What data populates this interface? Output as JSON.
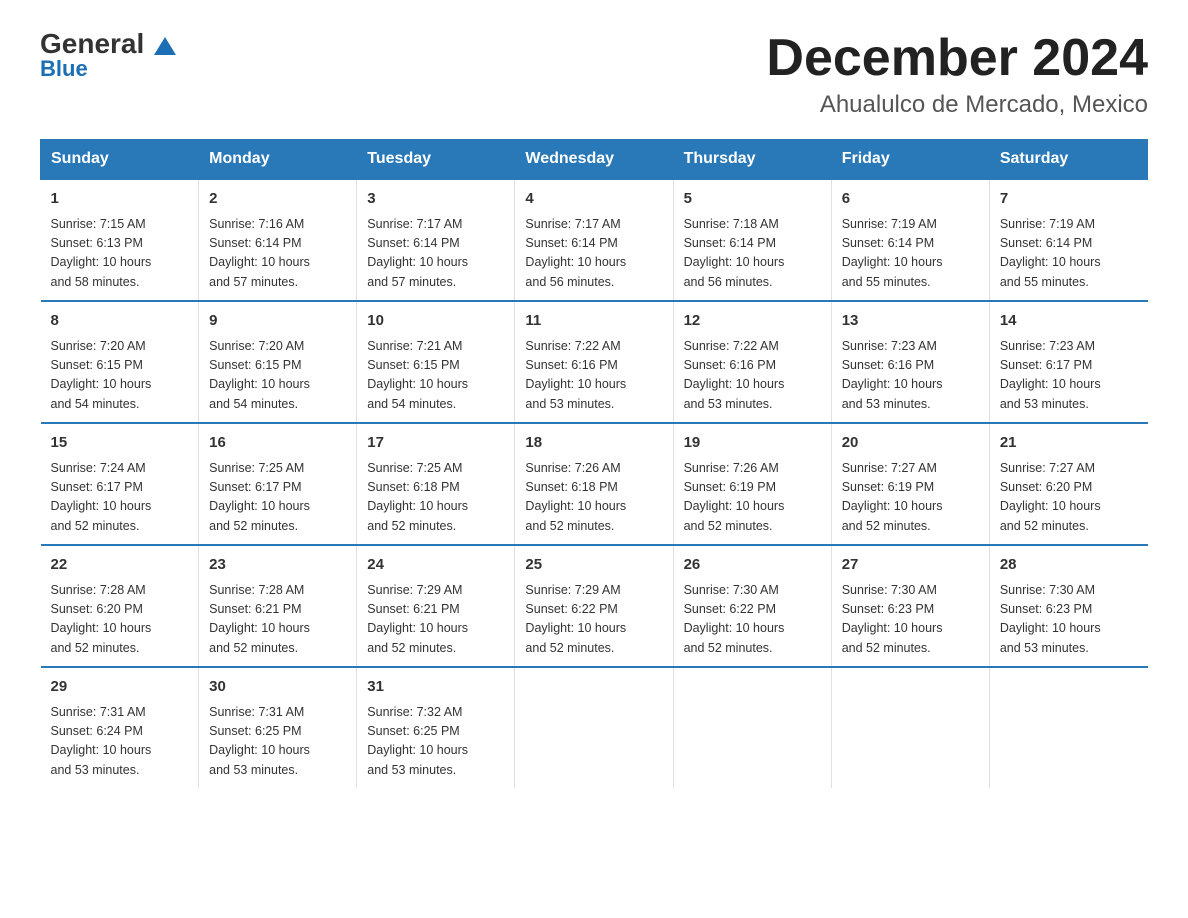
{
  "logo": {
    "general": "General",
    "blue": "Blue"
  },
  "title": "December 2024",
  "subtitle": "Ahualulco de Mercado, Mexico",
  "weekdays": [
    "Sunday",
    "Monday",
    "Tuesday",
    "Wednesday",
    "Thursday",
    "Friday",
    "Saturday"
  ],
  "weeks": [
    [
      {
        "day": "1",
        "sunrise": "7:15 AM",
        "sunset": "6:13 PM",
        "daylight": "10 hours and 58 minutes."
      },
      {
        "day": "2",
        "sunrise": "7:16 AM",
        "sunset": "6:14 PM",
        "daylight": "10 hours and 57 minutes."
      },
      {
        "day": "3",
        "sunrise": "7:17 AM",
        "sunset": "6:14 PM",
        "daylight": "10 hours and 57 minutes."
      },
      {
        "day": "4",
        "sunrise": "7:17 AM",
        "sunset": "6:14 PM",
        "daylight": "10 hours and 56 minutes."
      },
      {
        "day": "5",
        "sunrise": "7:18 AM",
        "sunset": "6:14 PM",
        "daylight": "10 hours and 56 minutes."
      },
      {
        "day": "6",
        "sunrise": "7:19 AM",
        "sunset": "6:14 PM",
        "daylight": "10 hours and 55 minutes."
      },
      {
        "day": "7",
        "sunrise": "7:19 AM",
        "sunset": "6:14 PM",
        "daylight": "10 hours and 55 minutes."
      }
    ],
    [
      {
        "day": "8",
        "sunrise": "7:20 AM",
        "sunset": "6:15 PM",
        "daylight": "10 hours and 54 minutes."
      },
      {
        "day": "9",
        "sunrise": "7:20 AM",
        "sunset": "6:15 PM",
        "daylight": "10 hours and 54 minutes."
      },
      {
        "day": "10",
        "sunrise": "7:21 AM",
        "sunset": "6:15 PM",
        "daylight": "10 hours and 54 minutes."
      },
      {
        "day": "11",
        "sunrise": "7:22 AM",
        "sunset": "6:16 PM",
        "daylight": "10 hours and 53 minutes."
      },
      {
        "day": "12",
        "sunrise": "7:22 AM",
        "sunset": "6:16 PM",
        "daylight": "10 hours and 53 minutes."
      },
      {
        "day": "13",
        "sunrise": "7:23 AM",
        "sunset": "6:16 PM",
        "daylight": "10 hours and 53 minutes."
      },
      {
        "day": "14",
        "sunrise": "7:23 AM",
        "sunset": "6:17 PM",
        "daylight": "10 hours and 53 minutes."
      }
    ],
    [
      {
        "day": "15",
        "sunrise": "7:24 AM",
        "sunset": "6:17 PM",
        "daylight": "10 hours and 52 minutes."
      },
      {
        "day": "16",
        "sunrise": "7:25 AM",
        "sunset": "6:17 PM",
        "daylight": "10 hours and 52 minutes."
      },
      {
        "day": "17",
        "sunrise": "7:25 AM",
        "sunset": "6:18 PM",
        "daylight": "10 hours and 52 minutes."
      },
      {
        "day": "18",
        "sunrise": "7:26 AM",
        "sunset": "6:18 PM",
        "daylight": "10 hours and 52 minutes."
      },
      {
        "day": "19",
        "sunrise": "7:26 AM",
        "sunset": "6:19 PM",
        "daylight": "10 hours and 52 minutes."
      },
      {
        "day": "20",
        "sunrise": "7:27 AM",
        "sunset": "6:19 PM",
        "daylight": "10 hours and 52 minutes."
      },
      {
        "day": "21",
        "sunrise": "7:27 AM",
        "sunset": "6:20 PM",
        "daylight": "10 hours and 52 minutes."
      }
    ],
    [
      {
        "day": "22",
        "sunrise": "7:28 AM",
        "sunset": "6:20 PM",
        "daylight": "10 hours and 52 minutes."
      },
      {
        "day": "23",
        "sunrise": "7:28 AM",
        "sunset": "6:21 PM",
        "daylight": "10 hours and 52 minutes."
      },
      {
        "day": "24",
        "sunrise": "7:29 AM",
        "sunset": "6:21 PM",
        "daylight": "10 hours and 52 minutes."
      },
      {
        "day": "25",
        "sunrise": "7:29 AM",
        "sunset": "6:22 PM",
        "daylight": "10 hours and 52 minutes."
      },
      {
        "day": "26",
        "sunrise": "7:30 AM",
        "sunset": "6:22 PM",
        "daylight": "10 hours and 52 minutes."
      },
      {
        "day": "27",
        "sunrise": "7:30 AM",
        "sunset": "6:23 PM",
        "daylight": "10 hours and 52 minutes."
      },
      {
        "day": "28",
        "sunrise": "7:30 AM",
        "sunset": "6:23 PM",
        "daylight": "10 hours and 53 minutes."
      }
    ],
    [
      {
        "day": "29",
        "sunrise": "7:31 AM",
        "sunset": "6:24 PM",
        "daylight": "10 hours and 53 minutes."
      },
      {
        "day": "30",
        "sunrise": "7:31 AM",
        "sunset": "6:25 PM",
        "daylight": "10 hours and 53 minutes."
      },
      {
        "day": "31",
        "sunrise": "7:32 AM",
        "sunset": "6:25 PM",
        "daylight": "10 hours and 53 minutes."
      },
      null,
      null,
      null,
      null
    ]
  ],
  "labels": {
    "sunrise": "Sunrise:",
    "sunset": "Sunset:",
    "daylight": "Daylight:"
  }
}
